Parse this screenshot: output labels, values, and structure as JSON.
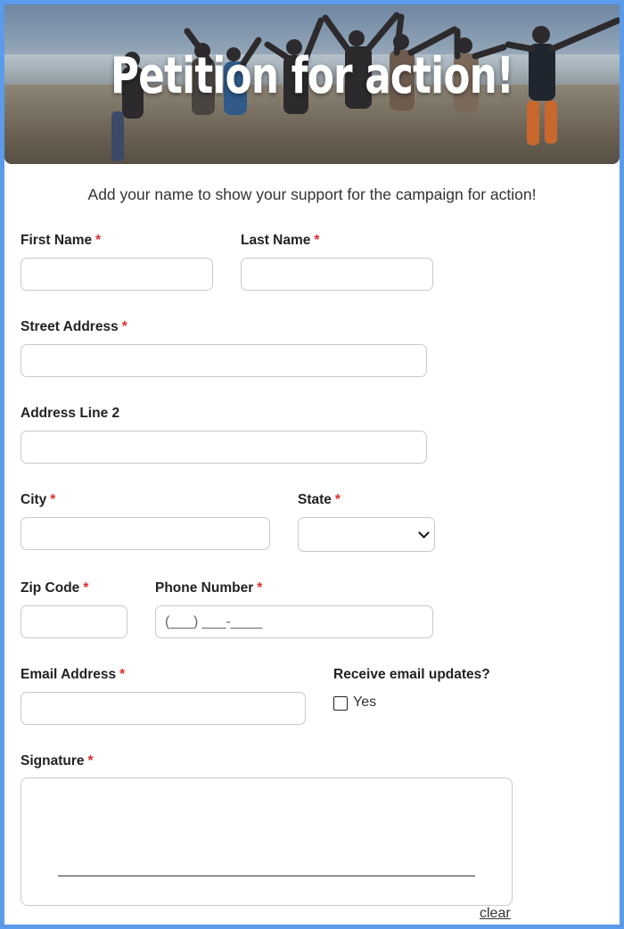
{
  "hero": {
    "title": "Petition for action!",
    "image_alt": "group-photo"
  },
  "subtitle": "Add your name to show your support for the campaign for action!",
  "required_marker": "*",
  "fields": {
    "first_name": {
      "label": "First Name",
      "value": ""
    },
    "last_name": {
      "label": "Last Name",
      "value": ""
    },
    "street_address": {
      "label": "Street Address",
      "value": ""
    },
    "address_line2": {
      "label": "Address Line 2",
      "value": ""
    },
    "city": {
      "label": "City",
      "value": ""
    },
    "state": {
      "label": "State",
      "selected": ""
    },
    "zip": {
      "label": "Zip Code",
      "value": ""
    },
    "phone": {
      "label": "Phone Number",
      "placeholder": "(___) ___-____"
    },
    "email": {
      "label": "Email Address",
      "value": ""
    },
    "updates": {
      "label": "Receive email updates?",
      "option": "Yes",
      "checked": false
    },
    "signature": {
      "label": "Signature",
      "clear": "clear"
    }
  },
  "colors": {
    "page_border": "#5b9bea",
    "required": "#e02a2a",
    "input_border": "#c9c9c9"
  }
}
